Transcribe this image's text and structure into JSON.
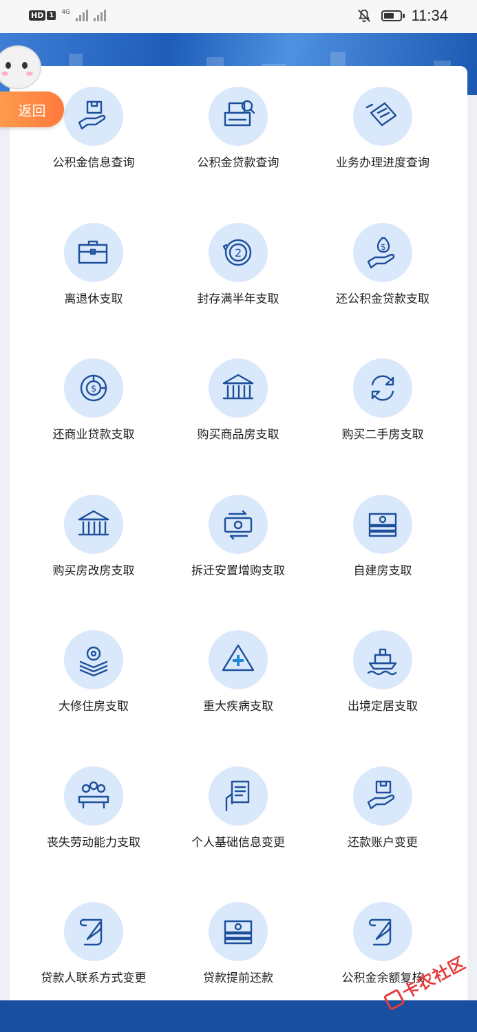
{
  "status_bar": {
    "hd_label": "HD",
    "sim_label": "1",
    "network_label": "4G",
    "time": "11:34"
  },
  "return_button": {
    "label": "返回"
  },
  "services": [
    {
      "label": "公积金信息查询",
      "icon": "hand-box-icon"
    },
    {
      "label": "公积金贷款查询",
      "icon": "printer-search-icon"
    },
    {
      "label": "业务办理进度查询",
      "icon": "document-icon"
    },
    {
      "label": "离退休支取",
      "icon": "briefcase-icon"
    },
    {
      "label": "封存满半年支取",
      "icon": "cycle-two-icon"
    },
    {
      "label": "还公积金贷款支取",
      "icon": "money-bag-hand-icon"
    },
    {
      "label": "还商业贷款支取",
      "icon": "dollar-chart-icon"
    },
    {
      "label": "购买商品房支取",
      "icon": "bank-building-icon"
    },
    {
      "label": "购买二手房支取",
      "icon": "refresh-icon"
    },
    {
      "label": "购买房改房支取",
      "icon": "bank-building-icon"
    },
    {
      "label": "拆迁安置增购支取",
      "icon": "money-transfer-icon"
    },
    {
      "label": "自建房支取",
      "icon": "cash-stack-icon"
    },
    {
      "label": "大修住房支取",
      "icon": "gear-layers-icon"
    },
    {
      "label": "重大疾病支取",
      "icon": "medical-cross-icon"
    },
    {
      "label": "出境定居支取",
      "icon": "ship-icon"
    },
    {
      "label": "丧失劳动能力支取",
      "icon": "meeting-people-icon"
    },
    {
      "label": "个人基础信息变更",
      "icon": "hand-document-icon"
    },
    {
      "label": "还款账户变更",
      "icon": "hand-box-icon"
    },
    {
      "label": "贷款人联系方式变更",
      "icon": "scroll-quill-icon"
    },
    {
      "label": "贷款提前还款",
      "icon": "cash-stack-icon"
    },
    {
      "label": "公积金余额复核",
      "icon": "scroll-quill-icon"
    }
  ],
  "watermark": {
    "text": "卡农社区"
  },
  "colors": {
    "accent": "#1e5db9",
    "icon_bg": "#d9e8fb",
    "return_button": "#ff8a44"
  }
}
